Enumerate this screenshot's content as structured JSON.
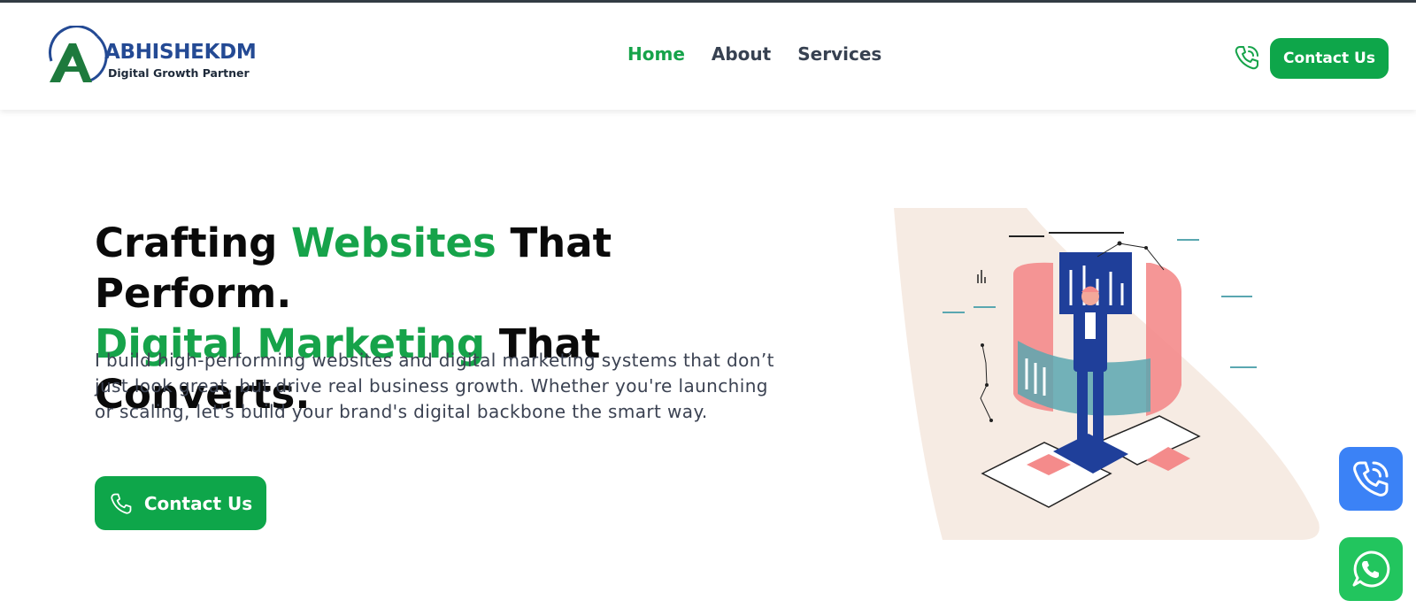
{
  "brand": {
    "name": "ABHISHEKDM",
    "tagline": "Digital Growth Partner",
    "logo_letter": "A"
  },
  "nav": {
    "items": [
      {
        "label": "Home",
        "active": true
      },
      {
        "label": "About",
        "active": false
      },
      {
        "label": "Services",
        "active": false
      }
    ]
  },
  "header": {
    "contact_label": "Contact Us",
    "phone_icon": "phone-icon"
  },
  "hero": {
    "title_line1_part1": "Crafting ",
    "title_line1_accent": "Websites",
    "title_line1_part2": " That Perform.",
    "title_line2_accent": "Digital Marketing",
    "title_line2_part2": " That Converts.",
    "description": "I build high-performing websites and digital marketing systems that don’t just look great, but drive real business growth. Whether you're launching or scaling, let's build your brand's digital backbone the smart way.",
    "cta_label": "Contact Us"
  },
  "floating": {
    "call_icon": "phone-icon",
    "whatsapp_icon": "whatsapp-icon"
  },
  "colors": {
    "accent_green": "#16a34a",
    "button_green": "#0ea64a",
    "brand_blue": "#244a94",
    "float_blue": "#3b82f6",
    "float_green": "#22c55e",
    "illustration_bg": "#f6ebe3"
  }
}
